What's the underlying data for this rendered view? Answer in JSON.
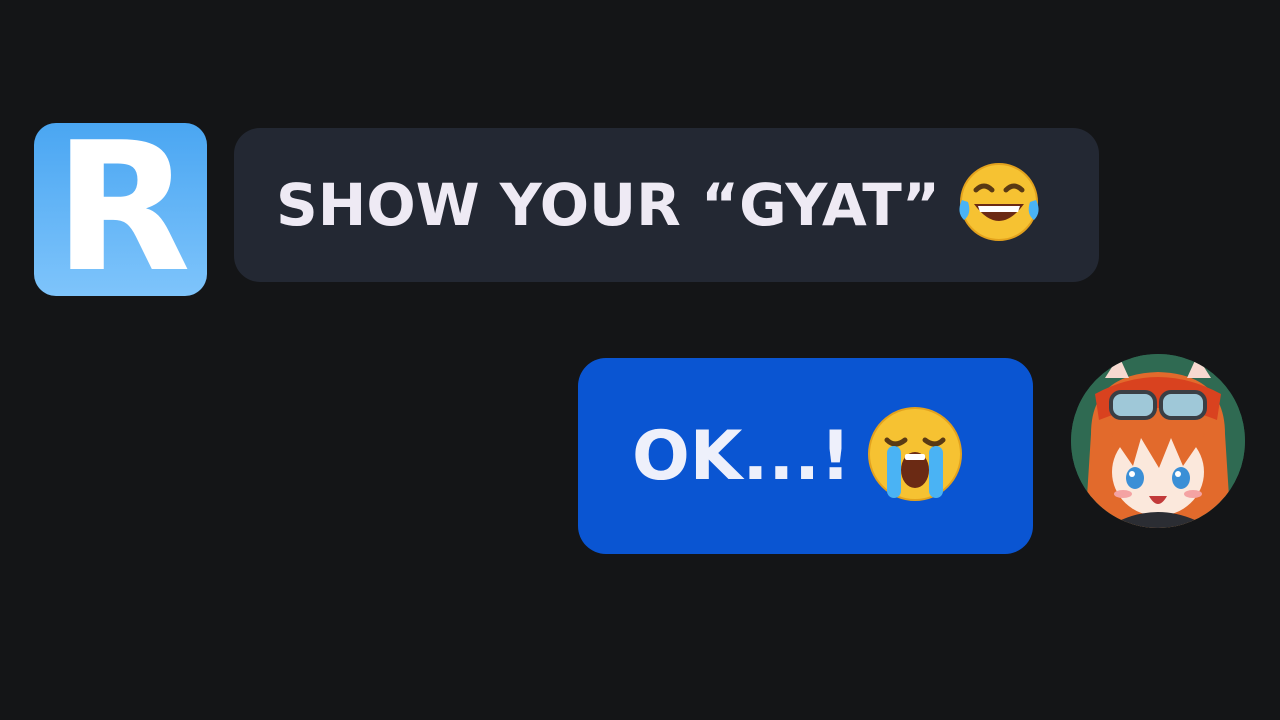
{
  "conversation": {
    "incoming": {
      "avatar_letter": "R",
      "message": "SHOW YOUR “GYAT”",
      "emoji_icon": "face-with-tears-of-joy-icon"
    },
    "outgoing": {
      "message": "OK...!",
      "emoji_icon": "loudly-crying-face-icon",
      "avatar_icon": "anime-character-avatar"
    }
  },
  "colors": {
    "background": "#141517",
    "incoming_bubble": "#232833",
    "outgoing_bubble": "#0a55d2",
    "app_avatar": "#4aa6f2"
  }
}
